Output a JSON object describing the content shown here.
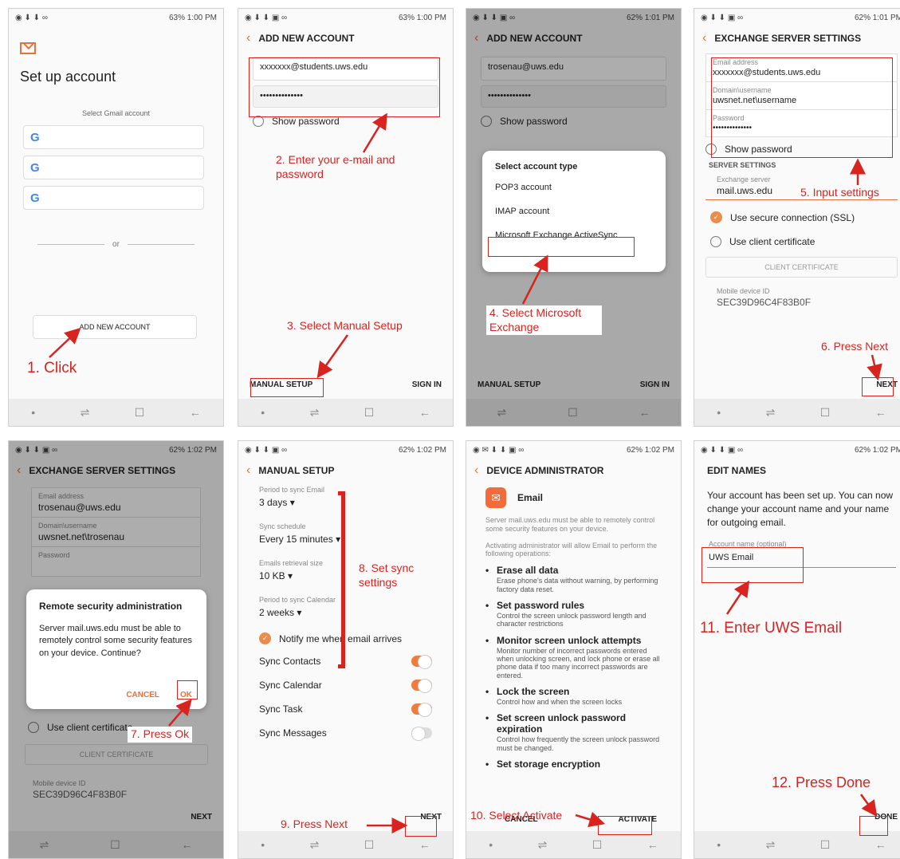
{
  "status": {
    "s1": {
      "right": "63% 1:00 PM"
    },
    "s2": {
      "right": "63% 1:00 PM"
    },
    "s3": {
      "right": "62% 1:01 PM"
    },
    "s4": {
      "right": "62% 1:01 PM"
    },
    "s5": {
      "right": "62% 1:02 PM"
    },
    "s6": {
      "right": "62% 1:02 PM"
    },
    "s7": {
      "right": "62% 1:02 PM"
    },
    "s8": {
      "right": "62% 1:02 PM"
    }
  },
  "screen1": {
    "title": "Set up account",
    "select_label": "Select Gmail account",
    "or": "or",
    "add_button": "ADD NEW ACCOUNT"
  },
  "screen2": {
    "title": "ADD NEW ACCOUNT",
    "email": "xxxxxxx@students.uws.edu",
    "password": "••••••••••••••",
    "show_password": "Show password",
    "manual_setup": "MANUAL SETUP",
    "sign_in": "SIGN IN"
  },
  "screen3": {
    "title": "ADD NEW ACCOUNT",
    "email": "trosenau@uws.edu",
    "password": "••••••••••••••",
    "show_password": "Show password",
    "popup_title": "Select account type",
    "options": [
      "POP3 account",
      "IMAP account",
      "Microsoft Exchange ActiveSync"
    ],
    "manual_setup": "MANUAL SETUP",
    "sign_in": "SIGN IN"
  },
  "screen4": {
    "title": "EXCHANGE SERVER SETTINGS",
    "email_label": "Email address",
    "email": "xxxxxxx@students.uws.edu",
    "domain_label": "Domain\\username",
    "domain": "uwsnet.net\\username",
    "password_label": "Password",
    "password": "••••••••••••••",
    "show_password": "Show password",
    "server_settings": "SERVER SETTINGS",
    "exchange_label": "Exchange server",
    "exchange": "mail.uws.edu",
    "ssl": "Use secure connection (SSL)",
    "client_cert": "Use client certificate",
    "client_cert_button": "CLIENT CERTIFICATE",
    "device_id_label": "Mobile device ID",
    "device_id": "SEC39D96C4F83B0F",
    "next": "NEXT"
  },
  "screen5": {
    "title": "EXCHANGE SERVER SETTINGS",
    "email_label": "Email address",
    "email": "trosenau@uws.edu",
    "domain_label": "Domain\\username",
    "domain": "uwsnet.net\\trosenau",
    "password_label": "Password",
    "dialog_title": "Remote security administration",
    "dialog_text": "Server mail.uws.edu must be able to remotely control some security features on your device. Continue?",
    "cancel": "CANCEL",
    "ok": "OK",
    "client_cert": "Use client certificate",
    "client_cert_button": "CLIENT CERTIFICATE",
    "device_id_label": "Mobile device ID",
    "device_id": "SEC39D96C4F83B0F",
    "next": "NEXT"
  },
  "screen6": {
    "title": "MANUAL SETUP",
    "period_email_label": "Period to sync Email",
    "period_email": "3 days",
    "schedule_label": "Sync schedule",
    "schedule": "Every 15 minutes",
    "retrieval_label": "Emails retrieval size",
    "retrieval": "10 KB",
    "period_cal_label": "Period to sync Calendar",
    "period_cal": "2 weeks",
    "notify": "Notify me when email arrives",
    "toggles": [
      {
        "label": "Sync Contacts",
        "on": true
      },
      {
        "label": "Sync Calendar",
        "on": true
      },
      {
        "label": "Sync Task",
        "on": true
      },
      {
        "label": "Sync Messages",
        "on": false
      }
    ],
    "next": "NEXT"
  },
  "screen7": {
    "title": "DEVICE ADMINISTRATOR",
    "app": "Email",
    "intro1": "Server mail.uws.edu must be able to remotely control some security features on your device.",
    "intro2": "Activating administrator will allow Email to perform the following operations:",
    "items": [
      {
        "title": "Erase all data",
        "desc": "Erase phone's data without warning, by performing factory data reset."
      },
      {
        "title": "Set password rules",
        "desc": "Control the screen unlock password length and character restrictions"
      },
      {
        "title": "Monitor screen unlock attempts",
        "desc": "Monitor number of incorrect passwords entered when unlocking screen, and lock phone or erase all phone data if too many incorrect passwords are entered."
      },
      {
        "title": "Lock the screen",
        "desc": "Control how and when the screen locks"
      },
      {
        "title": "Set screen unlock password expiration",
        "desc": "Control how frequently the screen unlock password must be changed."
      },
      {
        "title": "Set storage encryption",
        "desc": ""
      }
    ],
    "cancel": "CANCEL",
    "activate": "ACTIVATE"
  },
  "screen8": {
    "title": "EDIT NAMES",
    "text": "Your account has been set up. You can now change your account name and your name for outgoing email.",
    "account_label": "Account name (optional)",
    "account": "UWS Email",
    "done": "DONE"
  },
  "annotations": {
    "a1": "1. Click",
    "a2": "2. Enter your e-mail and password",
    "a3": "3. Select Manual Setup",
    "a4": "4. Select Microsoft Exchange",
    "a5": "5. Input settings",
    "a6": "6. Press Next",
    "a7": "7. Press Ok",
    "a8": "8. Set sync settings",
    "a9": "9. Press Next",
    "a10": "10. Select Activate",
    "a11": "11. Enter UWS Email",
    "a12": "12. Press Done"
  },
  "colors": {
    "accent": "#e8713a",
    "annotation": "#d9231f"
  }
}
